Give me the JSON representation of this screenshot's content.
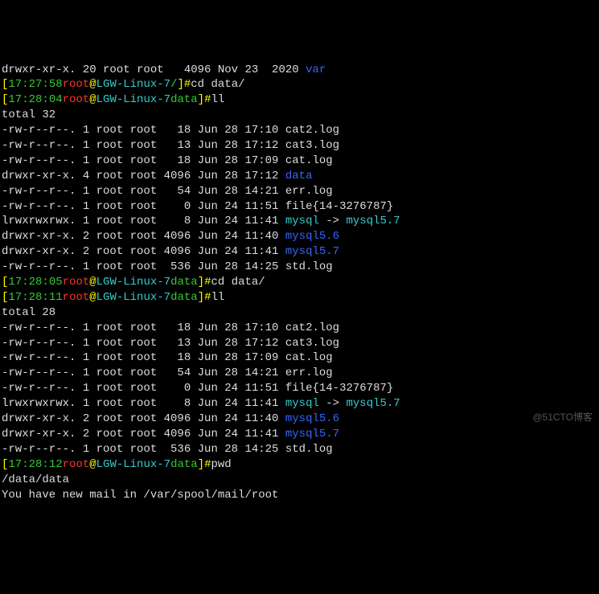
{
  "top_line": {
    "perms": "drwxr-xr-x.",
    "links": "20",
    "owner": "root",
    "group": "root",
    "size": "4096",
    "date": "Nov 23  2020",
    "name": "var"
  },
  "prompts": [
    {
      "time": "17:27:58",
      "user": "root",
      "at": "@",
      "host": "LGW-Linux-7",
      "path": "/",
      "cmd": "cd data/"
    },
    {
      "time": "17:28:04",
      "user": "root",
      "at": "@",
      "host": "LGW-Linux-7",
      "path": "data",
      "cmd": "ll"
    },
    {
      "time": "17:28:05",
      "user": "root",
      "at": "@",
      "host": "LGW-Linux-7",
      "path": "data",
      "cmd": "cd data/"
    },
    {
      "time": "17:28:11",
      "user": "root",
      "at": "@",
      "host": "LGW-Linux-7",
      "path": "data",
      "cmd": "ll"
    },
    {
      "time": "17:28:12",
      "user": "root",
      "at": "@",
      "host": "LGW-Linux-7",
      "path": "data",
      "cmd": "pwd"
    }
  ],
  "totals": [
    "total 32",
    "total 28"
  ],
  "listing1": [
    {
      "perms": "-rw-r--r--.",
      "links": "1",
      "owner": "root",
      "group": "root",
      "size": "18",
      "date": "Jun 28 17:10",
      "name": "cat2.log",
      "type": "file"
    },
    {
      "perms": "-rw-r--r--.",
      "links": "1",
      "owner": "root",
      "group": "root",
      "size": "13",
      "date": "Jun 28 17:12",
      "name": "cat3.log",
      "type": "file"
    },
    {
      "perms": "-rw-r--r--.",
      "links": "1",
      "owner": "root",
      "group": "root",
      "size": "18",
      "date": "Jun 28 17:09",
      "name": "cat.log",
      "type": "file"
    },
    {
      "perms": "drwxr-xr-x.",
      "links": "4",
      "owner": "root",
      "group": "root",
      "size": "4096",
      "date": "Jun 28 17:12",
      "name": "data",
      "type": "dir"
    },
    {
      "perms": "-rw-r--r--.",
      "links": "1",
      "owner": "root",
      "group": "root",
      "size": "54",
      "date": "Jun 28 14:21",
      "name": "err.log",
      "type": "file"
    },
    {
      "perms": "-rw-r--r--.",
      "links": "1",
      "owner": "root",
      "group": "root",
      "size": "0",
      "date": "Jun 24 11:51",
      "name": "file{14-3276787}",
      "type": "file"
    },
    {
      "perms": "lrwxrwxrwx.",
      "links": "1",
      "owner": "root",
      "group": "root",
      "size": "8",
      "date": "Jun 24 11:41",
      "name": "mysql",
      "arrow": " -> ",
      "target": "mysql5.7",
      "type": "link"
    },
    {
      "perms": "drwxr-xr-x.",
      "links": "2",
      "owner": "root",
      "group": "root",
      "size": "4096",
      "date": "Jun 24 11:40",
      "name": "mysql5.6",
      "type": "dir"
    },
    {
      "perms": "drwxr-xr-x.",
      "links": "2",
      "owner": "root",
      "group": "root",
      "size": "4096",
      "date": "Jun 24 11:41",
      "name": "mysql5.7",
      "type": "dir"
    },
    {
      "perms": "-rw-r--r--.",
      "links": "1",
      "owner": "root",
      "group": "root",
      "size": "536",
      "date": "Jun 28 14:25",
      "name": "std.log",
      "type": "file"
    }
  ],
  "listing2": [
    {
      "perms": "-rw-r--r--.",
      "links": "1",
      "owner": "root",
      "group": "root",
      "size": "18",
      "date": "Jun 28 17:10",
      "name": "cat2.log",
      "type": "file"
    },
    {
      "perms": "-rw-r--r--.",
      "links": "1",
      "owner": "root",
      "group": "root",
      "size": "13",
      "date": "Jun 28 17:12",
      "name": "cat3.log",
      "type": "file"
    },
    {
      "perms": "-rw-r--r--.",
      "links": "1",
      "owner": "root",
      "group": "root",
      "size": "18",
      "date": "Jun 28 17:09",
      "name": "cat.log",
      "type": "file"
    },
    {
      "perms": "-rw-r--r--.",
      "links": "1",
      "owner": "root",
      "group": "root",
      "size": "54",
      "date": "Jun 28 14:21",
      "name": "err.log",
      "type": "file"
    },
    {
      "perms": "-rw-r--r--.",
      "links": "1",
      "owner": "root",
      "group": "root",
      "size": "0",
      "date": "Jun 24 11:51",
      "name": "file{14-3276787}",
      "type": "file"
    },
    {
      "perms": "lrwxrwxrwx.",
      "links": "1",
      "owner": "root",
      "group": "root",
      "size": "8",
      "date": "Jun 24 11:41",
      "name": "mysql",
      "arrow": " -> ",
      "target": "mysql5.7",
      "type": "link"
    },
    {
      "perms": "drwxr-xr-x.",
      "links": "2",
      "owner": "root",
      "group": "root",
      "size": "4096",
      "date": "Jun 24 11:40",
      "name": "mysql5.6",
      "type": "dir"
    },
    {
      "perms": "drwxr-xr-x.",
      "links": "2",
      "owner": "root",
      "group": "root",
      "size": "4096",
      "date": "Jun 24 11:41",
      "name": "mysql5.7",
      "type": "dir"
    },
    {
      "perms": "-rw-r--r--.",
      "links": "1",
      "owner": "root",
      "group": "root",
      "size": "536",
      "date": "Jun 28 14:25",
      "name": "std.log",
      "type": "file"
    }
  ],
  "pwd_output": "/data/data",
  "mail_msg": "You have new mail in /var/spool/mail/root",
  "watermark": "@51CTO博客",
  "bracket_open": "[",
  "bracket_close": "]",
  "hash": "#"
}
